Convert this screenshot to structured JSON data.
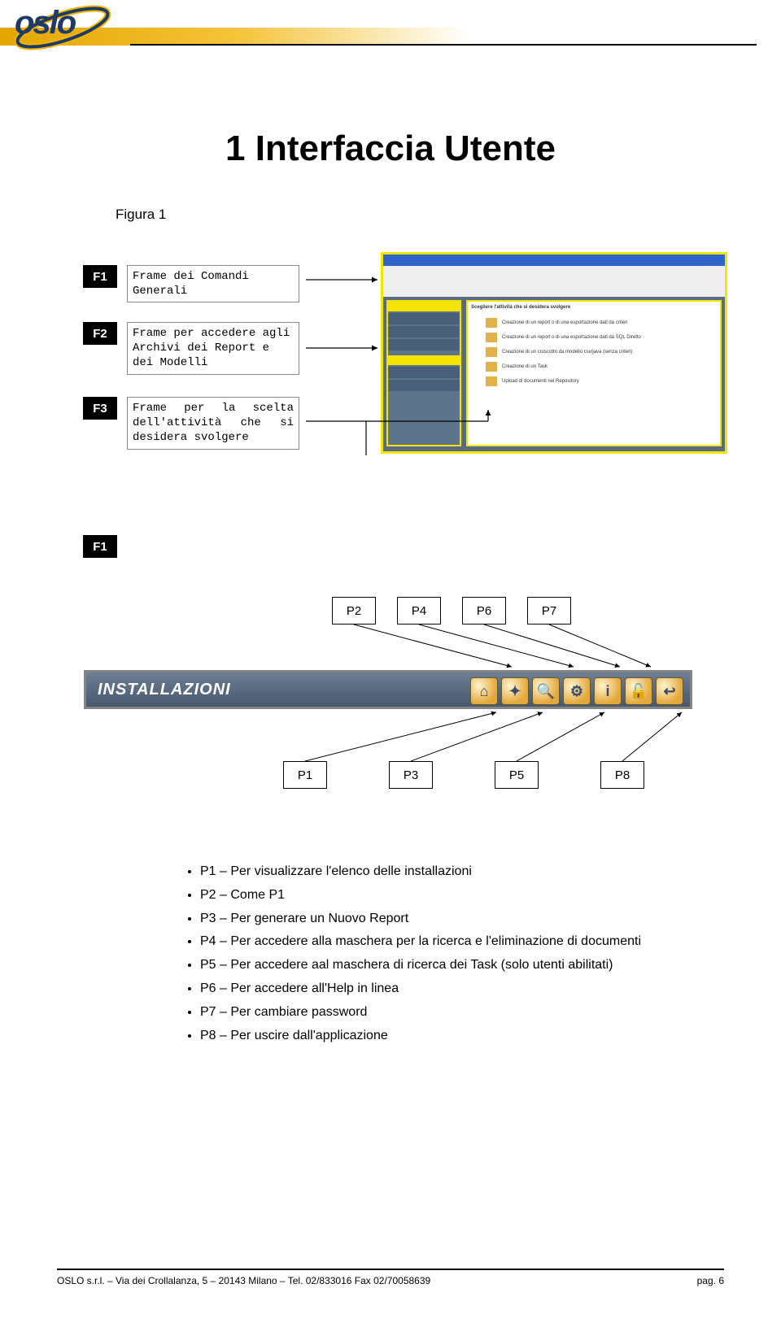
{
  "logo_text": "oslo",
  "title": "1 Interfaccia Utente",
  "figura": "Figura 1",
  "frames": {
    "f1": {
      "tag": "F1",
      "desc": "Frame dei Comandi Generali"
    },
    "f2": {
      "tag": "F2",
      "desc": "Frame per accedere agli Archivi dei Report e dei Modelli"
    },
    "f3": {
      "tag": "F3",
      "desc": "Frame per la scelta dell'attività che si desidera svolgere"
    }
  },
  "f1_repeat": "F1",
  "p_top": {
    "p2": "P2",
    "p4": "P4",
    "p6": "P6",
    "p7": "P7"
  },
  "p_bot": {
    "p1": "P1",
    "p3": "P3",
    "p5": "P5",
    "p8": "P8"
  },
  "install_label": "INSTALLAZIONI",
  "toolbar_icons": {
    "home": "⌂",
    "gen": "✦",
    "search": "🔍",
    "gear": "⚙",
    "info": "i",
    "lock": "🔓",
    "exit": "↩"
  },
  "screenshot": {
    "activity_header": "Scegliere l'attività che si desidera svolgere",
    "rows": {
      "r1": "Creazione di un report o di una esportazione dati da criteri",
      "r2": "Creazione di un report o di una esportazione dati da SQL Diretto",
      "r3": "Creazione di un cruscotto da modello csv/java (senza criteri)",
      "r4": "Creazione di un Task",
      "r5": "Upload di documenti nel Repository"
    }
  },
  "bullets": {
    "b1": "P1 – Per visualizzare l'elenco delle installazioni",
    "b2": "P2 – Come P1",
    "b3": "P3 – Per generare un Nuovo Report",
    "b4": "P4 – Per accedere alla maschera per la ricerca e l'eliminazione di documenti",
    "b5": "P5 – Per accedere aal maschera di ricerca dei Task (solo utenti abilitati)",
    "b6": "P6 – Per accedere all'Help in linea",
    "b7": "P7 – Per cambiare password",
    "b8": "P8 – Per uscire dall'applicazione"
  },
  "footer": {
    "left": "OSLO s.r.l. – Via dei Crollalanza, 5 – 20143 Milano – Tel. 02/833016 Fax 02/70058639",
    "right": "pag. 6"
  }
}
